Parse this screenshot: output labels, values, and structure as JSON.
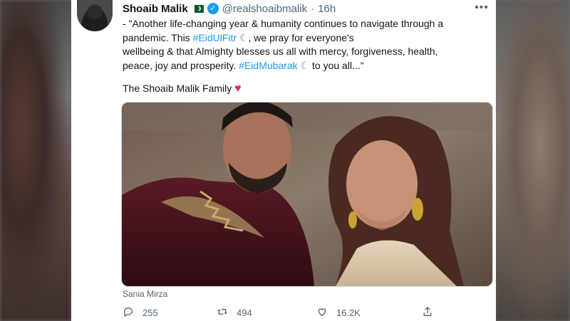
{
  "tweet": {
    "author_name": "Shoaib Malik",
    "author_handle": "@realshoaibmalik",
    "separator": "·",
    "time": "16h",
    "text_line1": "- \"Another life-changing year & humanity continues to navigate through a",
    "text_line2_a": "pandemic. This ",
    "hashtag1": "#EidUlFitr",
    "moon1": "☾",
    "text_line2_b": ", we pray for everyone's",
    "text_line3": "wellbeing & that Almighty blesses us all with mercy, forgiveness, health,",
    "text_line4_a": "peace, joy and prosperity. ",
    "hashtag2": "#EidMubarak",
    "moon2": "☾",
    "text_line4_b": " to you all...\"",
    "family_line": "The Shoaib Malik Family",
    "heart": "♥",
    "photo_tag": "Sania Mirza"
  },
  "actions": {
    "reply_count": "255",
    "retweet_count": "494",
    "like_count": "16.2K"
  },
  "icons": {
    "more": "more-icon",
    "verified": "verified-icon",
    "flag": "pakistan-flag-icon",
    "reply": "reply-icon",
    "retweet": "retweet-icon",
    "like": "like-icon",
    "share": "share-icon"
  },
  "colors": {
    "link": "#1d9bf0",
    "verified": "#1d9bf0",
    "heart": "#e0245e",
    "muted": "#536471"
  }
}
